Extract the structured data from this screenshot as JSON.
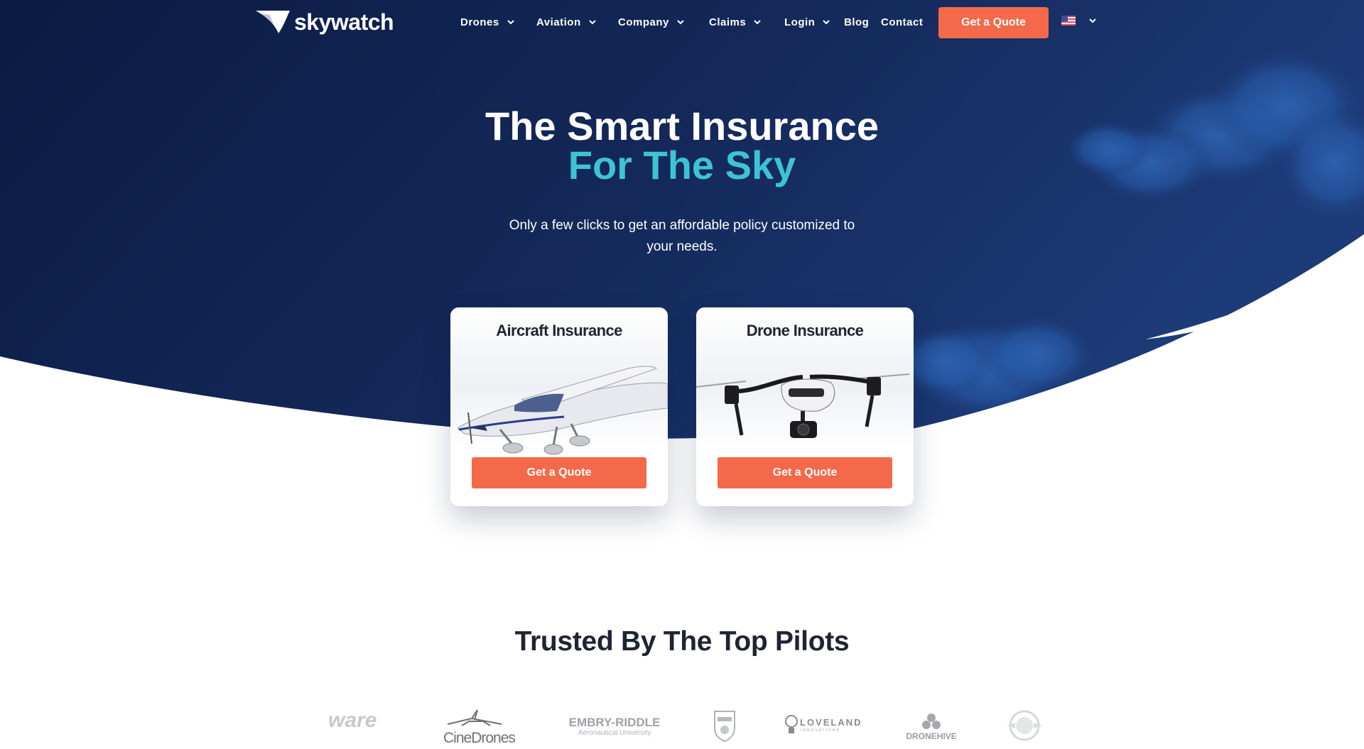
{
  "brand": {
    "name": "skywatch"
  },
  "nav": {
    "items": [
      {
        "label": "Drones",
        "dropdown": true
      },
      {
        "label": "Aviation",
        "dropdown": true
      },
      {
        "label": "Company",
        "dropdown": true
      },
      {
        "label": "Claims",
        "dropdown": true
      },
      {
        "label": "Login",
        "dropdown": true
      },
      {
        "label": "Blog",
        "dropdown": false
      },
      {
        "label": "Contact",
        "dropdown": false
      }
    ],
    "cta_label": "Get a Quote",
    "language_icon": "us-flag-icon"
  },
  "hero": {
    "title_line1": "The Smart Insurance",
    "title_line2": "For The Sky",
    "subtitle": "Only a few clicks to get an affordable policy customized to your needs."
  },
  "cards": [
    {
      "title": "Aircraft Insurance",
      "button_label": "Get a Quote",
      "image": "airplane-image"
    },
    {
      "title": "Drone Insurance",
      "button_label": "Get a Quote",
      "image": "drone-image"
    }
  ],
  "trusted": {
    "heading": "Trusted By The Top Pilots",
    "logos": [
      {
        "text": "ware"
      },
      {
        "text": "CineDrones"
      },
      {
        "text": "EMBRY-RIDDLE",
        "subtext": "Aeronautical University"
      },
      {
        "text": ""
      },
      {
        "text": "LOVELAND",
        "subtext": "INNOVATIONS"
      },
      {
        "text": "DRONEHIVE"
      },
      {
        "text": ""
      }
    ]
  },
  "colors": {
    "navy": "#0e1d45",
    "navy_light": "#1d3b78",
    "accent_cyan": "#3ec3d6",
    "cta_orange": "#f4694a",
    "heading_dark": "#1f2433"
  }
}
